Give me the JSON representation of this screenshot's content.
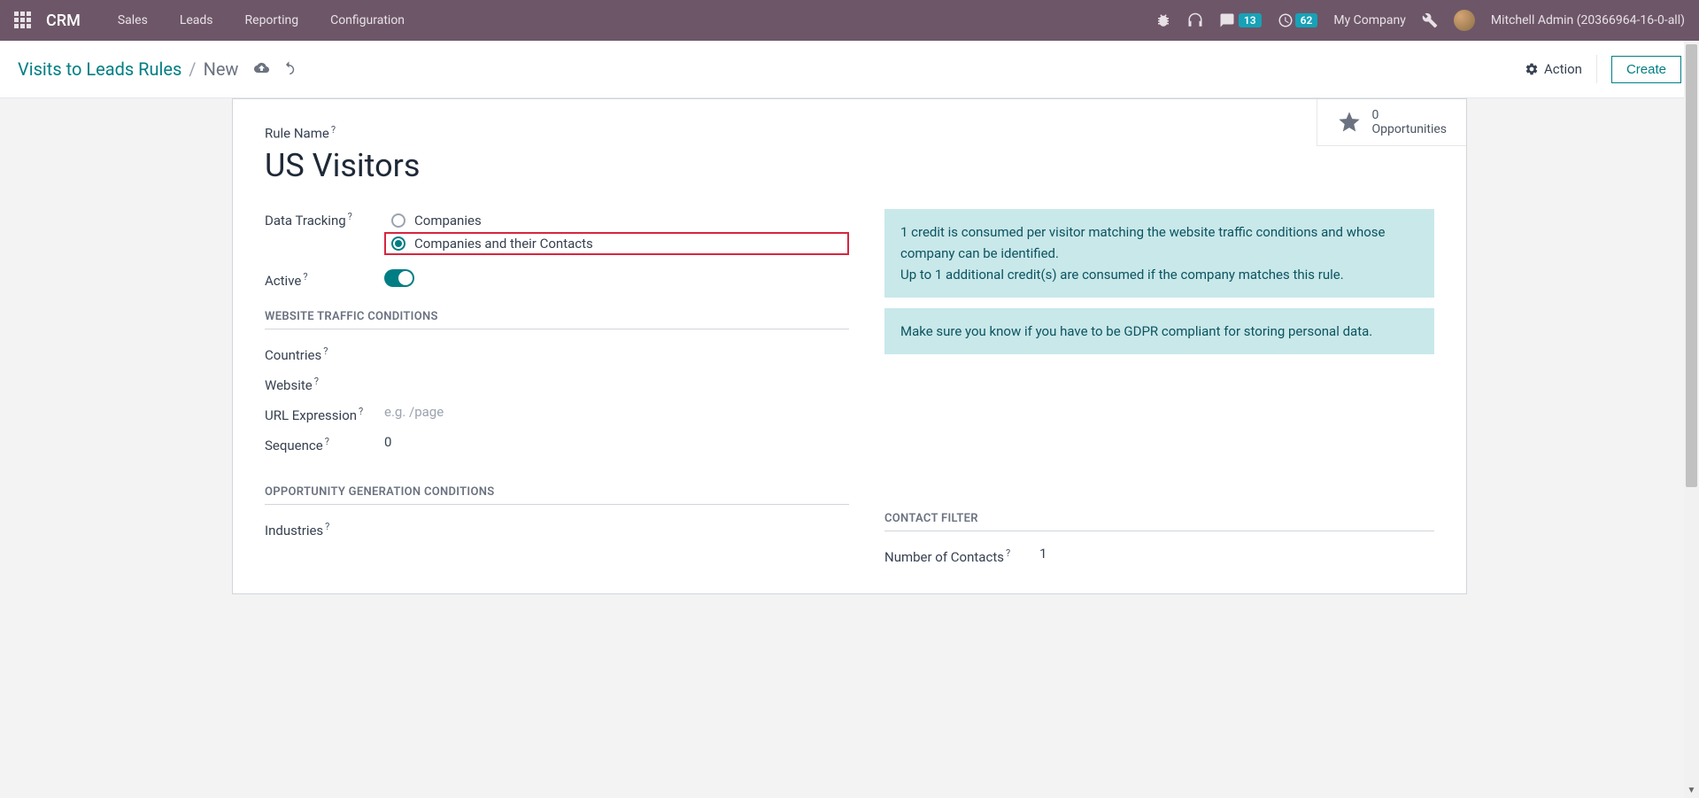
{
  "topnav": {
    "app_name": "CRM",
    "links": [
      "Sales",
      "Leads",
      "Reporting",
      "Configuration"
    ],
    "messages_count": "13",
    "clock_count": "62",
    "company": "My Company",
    "user": "Mitchell Admin (20366964-16-0-all)"
  },
  "breadcrumb": {
    "parent": "Visits to Leads Rules",
    "current": "New",
    "action_label": "Action",
    "create_label": "Create"
  },
  "stat": {
    "count": "0",
    "label": "Opportunities"
  },
  "form": {
    "rule_name_label": "Rule Name",
    "rule_name_value": "US Visitors",
    "data_tracking_label": "Data Tracking",
    "radio_companies": "Companies",
    "radio_companies_contacts": "Companies and their Contacts",
    "active_label": "Active",
    "alert1_line1": "1 credit is consumed per visitor matching the website traffic conditions and whose company can be identified.",
    "alert1_line2": "Up to 1 additional credit(s) are consumed if the company matches this rule.",
    "alert2": "Make sure you know if you have to be GDPR compliant for storing personal data.",
    "section_traffic": "WEBSITE TRAFFIC CONDITIONS",
    "countries_label": "Countries",
    "website_label": "Website",
    "url_expr_label": "URL Expression",
    "url_expr_placeholder": "e.g. /page",
    "sequence_label": "Sequence",
    "sequence_value": "0",
    "section_opp": "OPPORTUNITY GENERATION CONDITIONS",
    "industries_label": "Industries",
    "section_contact": "CONTACT FILTER",
    "num_contacts_label": "Number of Contacts",
    "num_contacts_value": "1"
  }
}
